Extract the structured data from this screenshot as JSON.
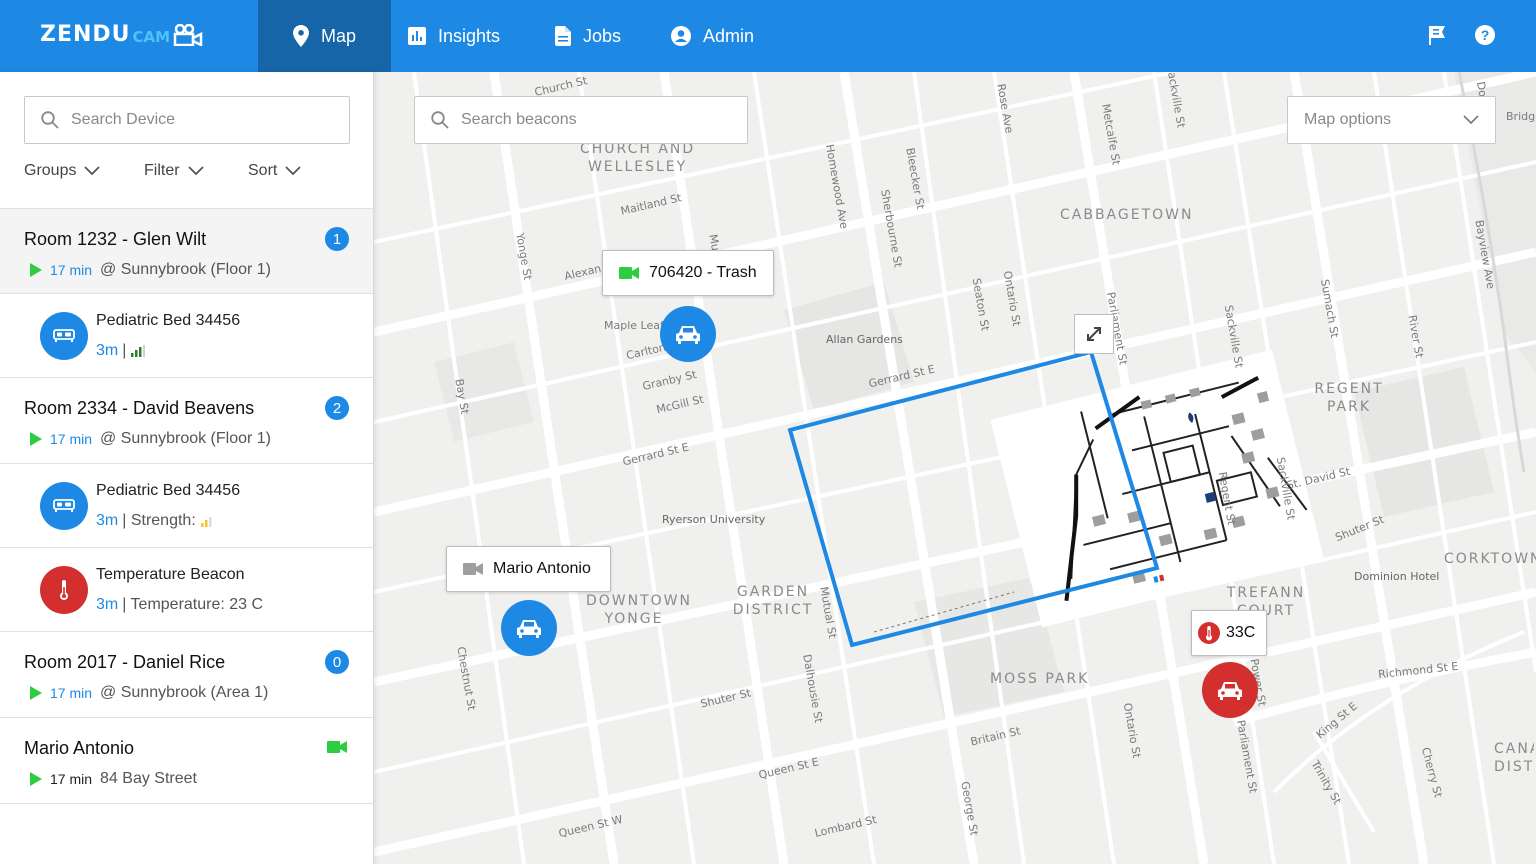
{
  "brand": {
    "name": "ZENDU",
    "suffix": "CAM"
  },
  "nav": {
    "tabs": [
      {
        "label": "Map",
        "icon": "location-pin-icon",
        "active": true
      },
      {
        "label": "Insights",
        "icon": "bar-chart-icon"
      },
      {
        "label": "Jobs",
        "icon": "document-icon"
      },
      {
        "label": "Admin",
        "icon": "account-circle-icon"
      }
    ],
    "right_icons": [
      "flag-icon",
      "help-icon"
    ]
  },
  "sidebar": {
    "search_placeholder": "Search Device",
    "filters": [
      {
        "label": "Groups"
      },
      {
        "label": "Filter"
      },
      {
        "label": "Sort"
      }
    ],
    "items": [
      {
        "type": "room",
        "title": "Room 1232 - Glen Wilt",
        "badge": "1",
        "time": "17 min",
        "location": "@ Sunnybrook (Floor 1)",
        "selected": true
      },
      {
        "type": "device",
        "name": "Pediatric Bed 34456",
        "distance": "3m",
        "detail": "|",
        "icon": "bed-icon",
        "color": "#1e88e5",
        "signal_color": "#2e7d32",
        "signal_bars": 3
      },
      {
        "type": "room",
        "title": "Room 2334 - David Beavens",
        "badge": "2",
        "time": "17 min",
        "location": "@ Sunnybrook (Floor 1)"
      },
      {
        "type": "device",
        "name": "Pediatric Bed 34456",
        "distance": "3m",
        "detail": "| Strength:",
        "icon": "bed-icon",
        "color": "#1e88e5",
        "signal_color": "#fbc02d",
        "signal_bars": 2
      },
      {
        "type": "device",
        "name": "Temperature Beacon",
        "distance": "3m",
        "detail": "| Temperature: 23 C",
        "icon": "thermometer-icon",
        "color": "#d32f2f"
      },
      {
        "type": "room",
        "title": "Room 2017 - Daniel Rice",
        "badge": "0",
        "time": "17 min",
        "location": "@ Sunnybrook (Area 1)"
      },
      {
        "type": "vehicle",
        "title": "Mario Antonio",
        "time": "17 min",
        "location": "84 Bay Street",
        "icon": "video-camera-icon",
        "icon_color": "#2ecc40"
      }
    ]
  },
  "map": {
    "search_placeholder": "Search beacons",
    "options_label": "Map options",
    "popups": [
      {
        "label": "706420 - Trash",
        "icon": "video-camera-icon",
        "icon_color": "#2ecc40"
      },
      {
        "label": "Mario Antonio",
        "icon": "video-camera-icon",
        "icon_color": "#9e9e9e"
      },
      {
        "label": "33C",
        "icon": "thermometer-icon",
        "icon_color": "#d32f2f"
      }
    ],
    "markers": [
      {
        "icon": "car-icon",
        "color": "#1e88e5"
      },
      {
        "icon": "car-icon",
        "color": "#1e88e5"
      },
      {
        "icon": "car-icon",
        "color": "#d32f2f"
      }
    ],
    "districts": [
      "CHURCH AND\nWELLESLEY",
      "CABBAGETOWN",
      "REGENT\nPARK",
      "GARDEN\nDISTRICT",
      "DOWNTOWN\nYONGE",
      "MOSS PARK",
      "TREFANN\nCOURT",
      "CORKTOWN",
      "CANA\nDISTR"
    ],
    "streets": [
      "Church St",
      "Maitland St",
      "Alexan",
      "Maple Leaf",
      "Carlton",
      "Granby St",
      "McGill St",
      "Gerrard St E",
      "Gerrard St E",
      "Yonge St",
      "Bay St",
      "Homewood Ave",
      "Sherbourne St",
      "Bleecker St",
      "Rose Ave",
      "Metcalfe St",
      "Sackville St",
      "Seaton St",
      "Ontario St",
      "Parliament St",
      "Sumach St",
      "River St",
      "Bayview Ave",
      "Sackville St",
      "St. David St",
      "Regent St",
      "Sackville St",
      "Shuter St",
      "Mutual St",
      "Dalhousie St",
      "Shuter St",
      "Chestnut St",
      "Britain St",
      "Ontario St",
      "Queen St E",
      "George St",
      "Lombard St",
      "Queen St W",
      "Richmond St E",
      "King St E",
      "Trinity St",
      "Cherry St",
      "Power St",
      "Parliament St",
      "Bridg",
      "Don River",
      "Mu"
    ],
    "pois": [
      "Allan Gardens",
      "Ryerson University",
      "Dominion Hotel"
    ]
  }
}
